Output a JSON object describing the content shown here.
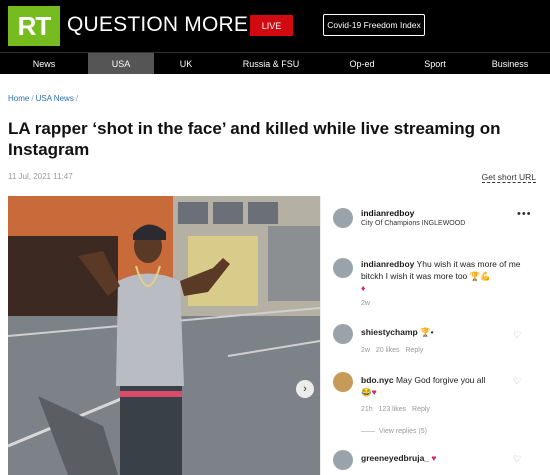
{
  "header": {
    "logo": "RT",
    "brand": "QUESTION MORE",
    "live_label": "LIVE",
    "covid_label": "Covid-19 Freedom Index"
  },
  "nav": [
    "News",
    "USA",
    "UK",
    "Russia & FSU",
    "Op-ed",
    "Sport",
    "Business"
  ],
  "nav_active": "USA",
  "breadcrumb": {
    "home": "Home",
    "section": "USA News"
  },
  "article": {
    "title": "LA rapper ‘shot in the face’ and killed while live streaming on Instagram",
    "date": "11 Jul, 2021 11:47",
    "short_url": "Get short URL"
  },
  "instagram": {
    "post_user": "indianredboy",
    "post_location": "City Of Champions INGLEWOOD",
    "comments": [
      {
        "user": "indianredboy",
        "text": "Yhu wish it was more of me bitckh I wish it was more too",
        "time": "2w"
      },
      {
        "user": "shiestychamp",
        "time": "2w",
        "likes": "20 likes",
        "reply": "Reply"
      },
      {
        "user": "bdo.nyc",
        "text": "May God forgive you all",
        "time": "21h",
        "likes": "123 likes",
        "reply": "Reply",
        "view_replies": "View replies (5)"
      },
      {
        "user": "greeneyedbruja_"
      }
    ]
  },
  "colors": {
    "rt_green": "#77bc1f",
    "live_red": "#d10a11",
    "link_blue": "#2a6fb5"
  }
}
